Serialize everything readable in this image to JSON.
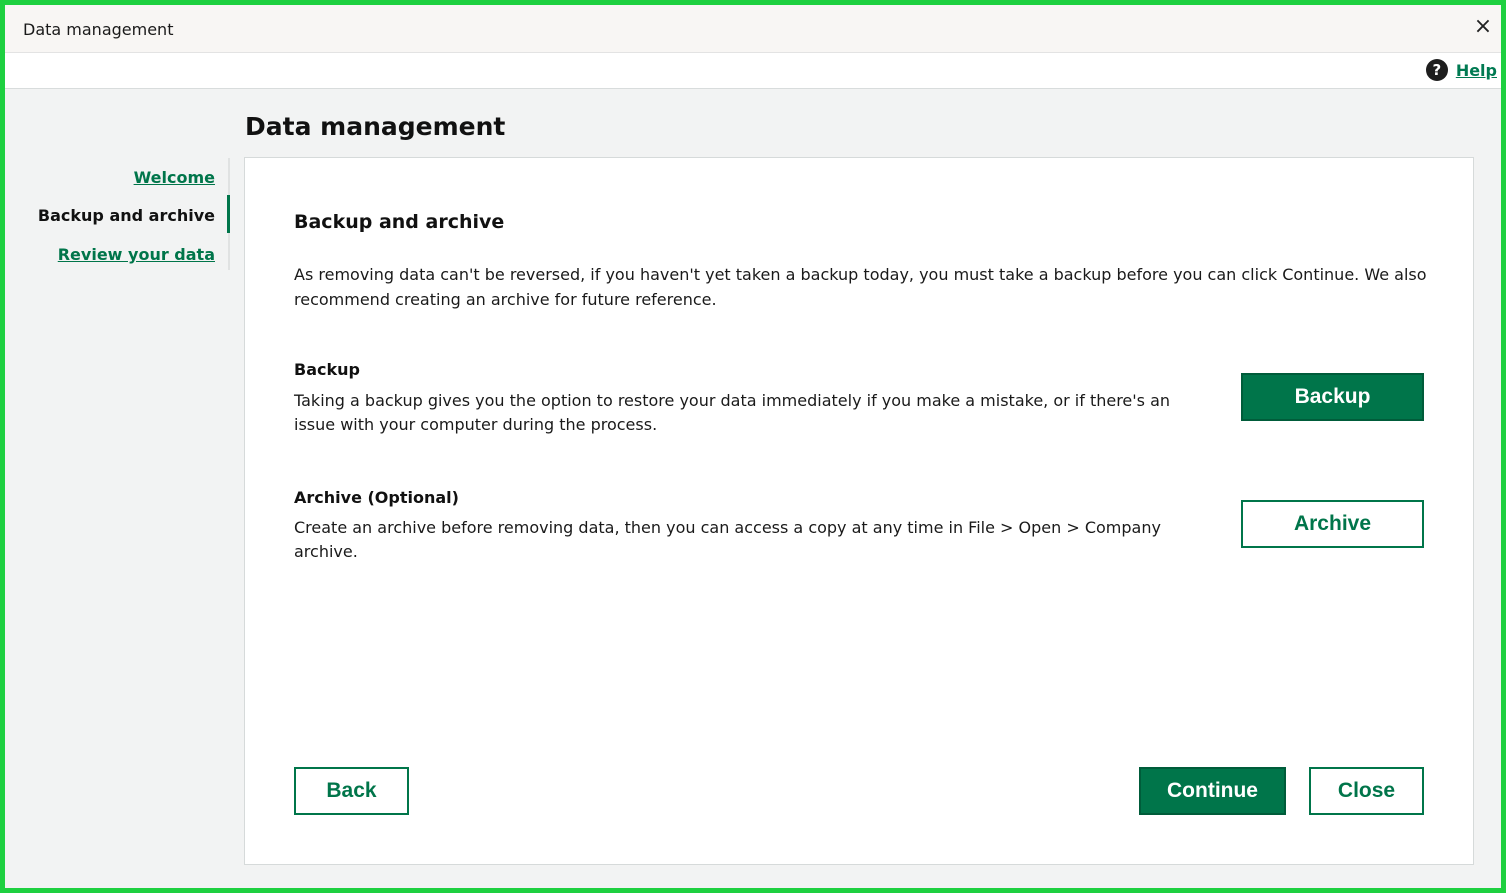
{
  "window": {
    "title": "Data management",
    "close_glyph": "×"
  },
  "helpbar": {
    "help_label": "Help",
    "help_icon": "question-circle-icon"
  },
  "page": {
    "title": "Data management"
  },
  "nav": {
    "items": [
      {
        "label": "Welcome",
        "state": "link"
      },
      {
        "label": "Backup and archive",
        "state": "current"
      },
      {
        "label": "Review your data",
        "state": "link"
      }
    ]
  },
  "content": {
    "section_title": "Backup and archive",
    "intro": "As removing data can't be reversed, if you haven't yet taken a backup today, you must take a backup before you can click Continue. We also recommend creating an archive for future reference.",
    "backup": {
      "title": "Backup",
      "description": "Taking a backup gives you the option to restore your data immediately if you make a mistake, or if there's an issue with your computer during the process.",
      "button_label": "Backup"
    },
    "archive": {
      "title": "Archive (Optional)",
      "description": "Create an archive before removing data, then you can access a copy at any time in File > Open > Company archive.",
      "button_label": "Archive"
    }
  },
  "footer": {
    "back_label": "Back",
    "continue_label": "Continue",
    "close_label": "Close"
  },
  "colors": {
    "accent": "#00754a",
    "frame_border": "#1ed040"
  }
}
